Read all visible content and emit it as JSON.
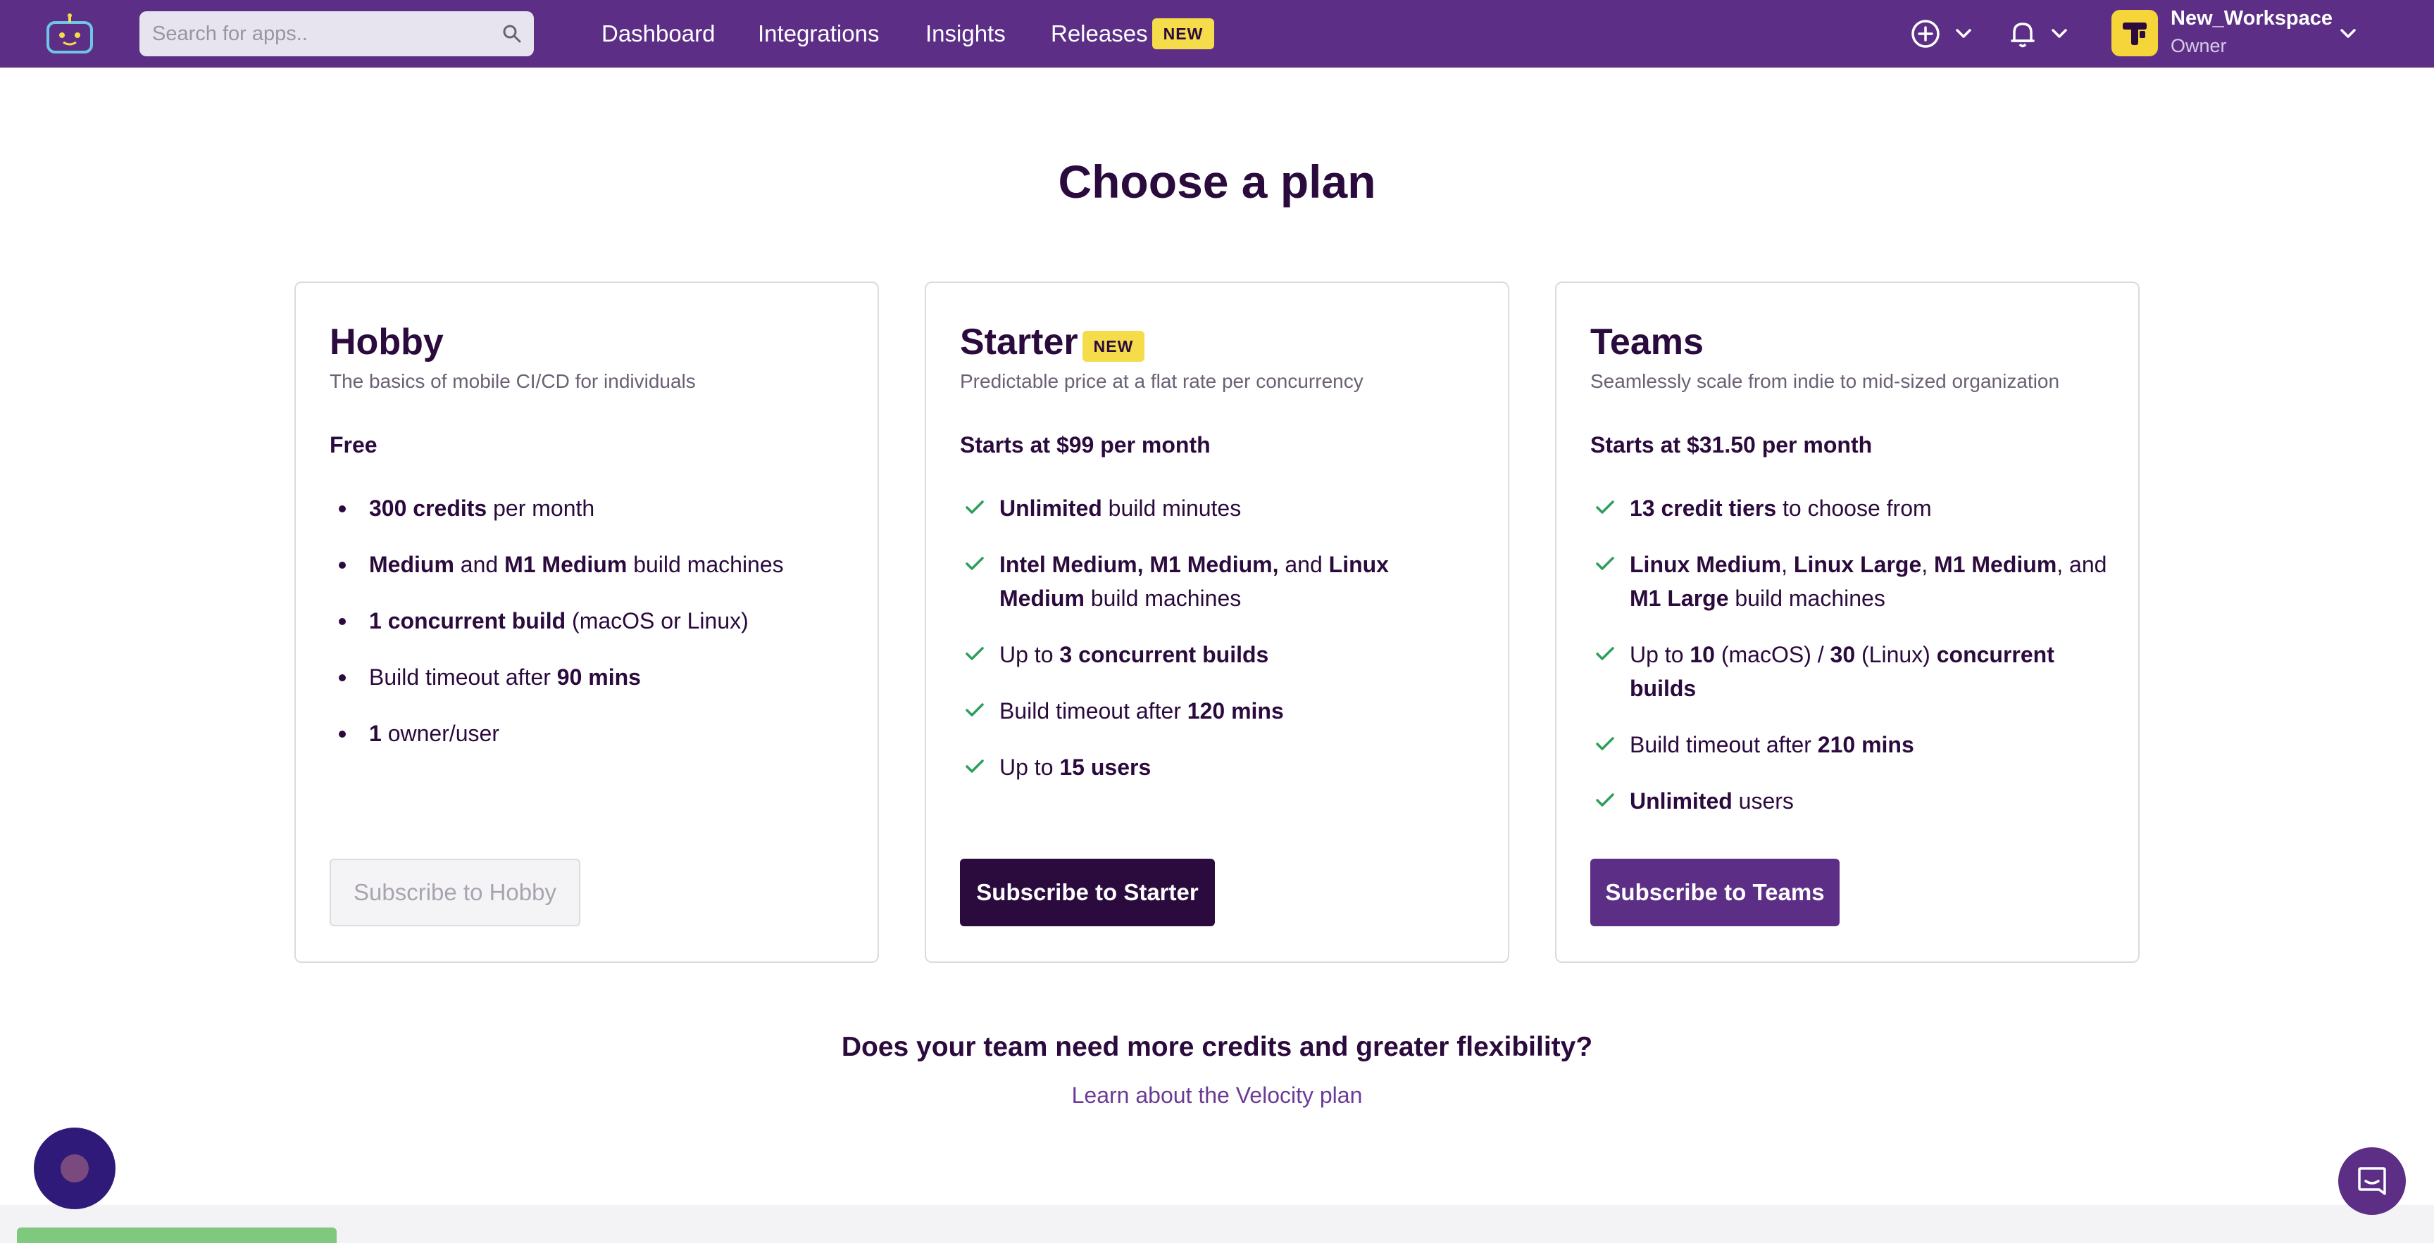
{
  "colors": {
    "topbar": "#5c2e86",
    "dark": "#2b0a3d",
    "badge": "#f4dc4a",
    "check": "#2e9e5b",
    "link": "#6a3b96"
  },
  "header": {
    "search_placeholder": "Search for apps..",
    "nav": [
      "Dashboard",
      "Integrations",
      "Insights",
      "Releases"
    ],
    "releases_badge": "NEW",
    "workspace_name": "New_Workspace",
    "workspace_role": "Owner",
    "icons": [
      "add-circle-icon",
      "bell-icon",
      "chevron-down-icon",
      "search-icon"
    ]
  },
  "page_title": "Choose a plan",
  "plans": [
    {
      "name": "Hobby",
      "subtitle": "The basics of mobile CI/CD for individuals",
      "price": "Free",
      "marker": "bullet",
      "features": [
        [
          [
            "300 credits",
            true
          ],
          [
            " per month",
            false
          ]
        ],
        [
          [
            "Medium",
            true
          ],
          [
            " and ",
            false
          ],
          [
            "M1 Medium",
            true
          ],
          [
            " build machines",
            false
          ]
        ],
        [
          [
            "1 concurrent build",
            true
          ],
          [
            " (macOS or Linux)",
            false
          ]
        ],
        [
          [
            "Build timeout after ",
            false
          ],
          [
            "90 mins",
            true
          ]
        ],
        [
          [
            "1",
            true
          ],
          [
            " owner/user",
            false
          ]
        ]
      ],
      "button": "Subscribe to Hobby"
    },
    {
      "name": "Starter",
      "badge": "NEW",
      "subtitle": "Predictable price at a flat rate per concurrency",
      "price": "Starts at $99 per month",
      "marker": "check",
      "features": [
        [
          [
            "Unlimited",
            true
          ],
          [
            " build minutes",
            false
          ]
        ],
        [
          [
            "Intel Medium, M1 Medium,",
            true
          ],
          [
            " and ",
            false
          ],
          [
            "Linux Medium",
            true
          ],
          [
            " build machines",
            false
          ]
        ],
        [
          [
            "Up to ",
            false
          ],
          [
            "3 concurrent builds",
            true
          ]
        ],
        [
          [
            "Build timeout after ",
            false
          ],
          [
            "120 mins",
            true
          ]
        ],
        [
          [
            "Up to ",
            false
          ],
          [
            "15 users",
            true
          ]
        ]
      ],
      "button": "Subscribe to Starter"
    },
    {
      "name": "Teams",
      "subtitle": "Seamlessly scale from indie to mid-sized organization",
      "price": "Starts at $31.50 per month",
      "marker": "check",
      "features": [
        [
          [
            "13 credit tiers",
            true
          ],
          [
            " to choose from",
            false
          ]
        ],
        [
          [
            "Linux Medium",
            true
          ],
          [
            ", ",
            false
          ],
          [
            "Linux Large",
            true
          ],
          [
            ", ",
            false
          ],
          [
            "M1 Medium",
            true
          ],
          [
            ", and ",
            false
          ],
          [
            "M1 Large",
            true
          ],
          [
            " build machines",
            false
          ]
        ],
        [
          [
            "Up to ",
            false
          ],
          [
            "10",
            true
          ],
          [
            " (macOS) / ",
            false
          ],
          [
            "30",
            true
          ],
          [
            " (Linux) ",
            false
          ],
          [
            "concurrent builds",
            true
          ]
        ],
        [
          [
            "Build timeout after ",
            false
          ],
          [
            "210 mins",
            true
          ]
        ],
        [
          [
            "Unlimited",
            true
          ],
          [
            " users",
            false
          ]
        ]
      ],
      "button": "Subscribe to Teams"
    }
  ],
  "more_question": "Does your team need more credits and greater flexibility?",
  "velocity_link": "Learn about the Velocity plan"
}
